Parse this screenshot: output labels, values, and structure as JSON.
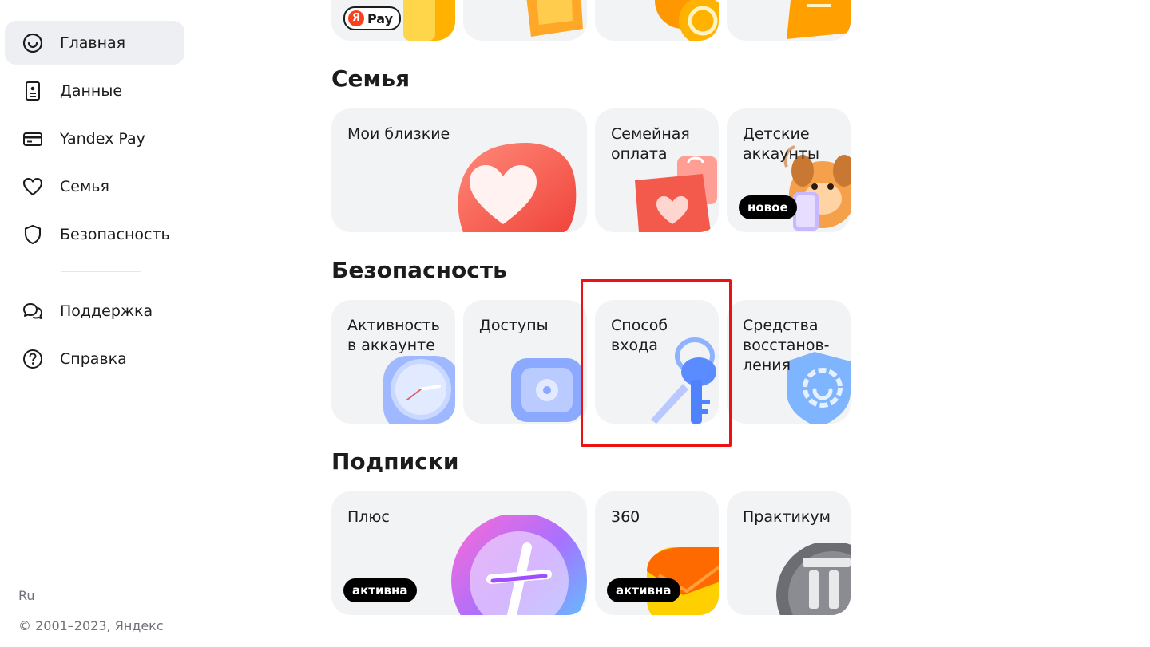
{
  "sidebar": {
    "items": [
      {
        "label": "Главная",
        "icon": "home-ring-icon",
        "active": true
      },
      {
        "label": "Данные",
        "icon": "id-card-icon"
      },
      {
        "label": "Yandex Pay",
        "icon": "credit-card-icon"
      },
      {
        "label": "Семья",
        "icon": "heart-icon"
      },
      {
        "label": "Безопасность",
        "icon": "shield-icon"
      },
      {
        "label": "Поддержка",
        "icon": "chat-bubbles-icon"
      },
      {
        "label": "Справка",
        "icon": "question-circle-icon"
      }
    ],
    "lang": "Ru",
    "copyright": "© 2001–2023, Яндекс"
  },
  "top_row": {
    "pay_pill": {
      "logo": "Я",
      "label": "Pay"
    }
  },
  "family": {
    "title": "Семья",
    "cards": [
      {
        "label": "Мои близкие",
        "icon": "heart-3d-icon"
      },
      {
        "label": "Семейная оплата",
        "icon": "heart-bag-icon"
      },
      {
        "label": "Детские аккаунты",
        "icon": "dog-phone-icon",
        "badge": "новое"
      }
    ]
  },
  "security": {
    "title": "Безопасность",
    "cards": [
      {
        "label": "Активность в аккаунте",
        "icon": "clock-icon"
      },
      {
        "label": "Доступы",
        "icon": "safe-icon"
      },
      {
        "label": "Способ входа",
        "icon": "keys-icon"
      },
      {
        "label": "Средства восстанов-ления",
        "icon": "shield-ring-icon"
      }
    ]
  },
  "subscriptions": {
    "title": "Подписки",
    "cards": [
      {
        "label": "Плюс",
        "icon": "plus-coin-icon",
        "badge": "активна"
      },
      {
        "label": "360",
        "icon": "envelope-360-icon",
        "badge": "активна"
      },
      {
        "label": "Практикум",
        "icon": "praktikum-coin-icon"
      }
    ]
  },
  "colors": {
    "accent_badge": "#000000",
    "highlight_border": "#ee1111",
    "card_bg": "#f2f3f5"
  }
}
